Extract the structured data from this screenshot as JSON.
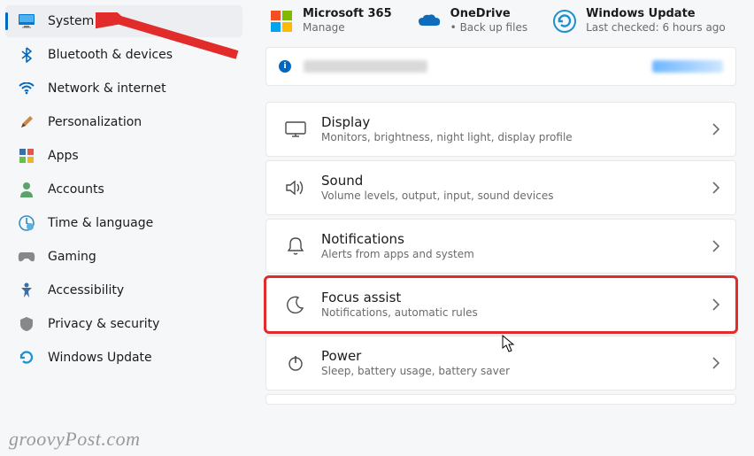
{
  "sidebar": {
    "items": [
      {
        "label": "System",
        "icon": "monitor-icon",
        "active": true
      },
      {
        "label": "Bluetooth & devices",
        "icon": "bluetooth-icon"
      },
      {
        "label": "Network & internet",
        "icon": "wifi-icon"
      },
      {
        "label": "Personalization",
        "icon": "brush-icon"
      },
      {
        "label": "Apps",
        "icon": "grid-icon"
      },
      {
        "label": "Accounts",
        "icon": "person-icon"
      },
      {
        "label": "Time & language",
        "icon": "clock-globe-icon"
      },
      {
        "label": "Gaming",
        "icon": "gamepad-icon"
      },
      {
        "label": "Accessibility",
        "icon": "accessibility-icon"
      },
      {
        "label": "Privacy & security",
        "icon": "shield-icon"
      },
      {
        "label": "Windows Update",
        "icon": "update-icon"
      }
    ]
  },
  "top": {
    "cards": [
      {
        "title": "Microsoft 365",
        "sub": "Manage",
        "icon": "microsoft-icon"
      },
      {
        "title": "OneDrive",
        "sub": "Back up files",
        "icon": "onedrive-icon",
        "bullet": true
      },
      {
        "title": "Windows Update",
        "sub": "Last checked: 6 hours ago",
        "icon": "update-icon"
      }
    ]
  },
  "info_bar": {
    "glyph": "i"
  },
  "settings": [
    {
      "title": "Display",
      "sub": "Monitors, brightness, night light, display profile",
      "icon": "display-icon"
    },
    {
      "title": "Sound",
      "sub": "Volume levels, output, input, sound devices",
      "icon": "sound-icon"
    },
    {
      "title": "Notifications",
      "sub": "Alerts from apps and system",
      "icon": "bell-icon"
    },
    {
      "title": "Focus assist",
      "sub": "Notifications, automatic rules",
      "icon": "moon-icon",
      "highlight": true
    },
    {
      "title": "Power",
      "sub": "Sleep, battery usage, battery saver",
      "icon": "power-icon"
    }
  ],
  "watermark": "groovyPost.com"
}
